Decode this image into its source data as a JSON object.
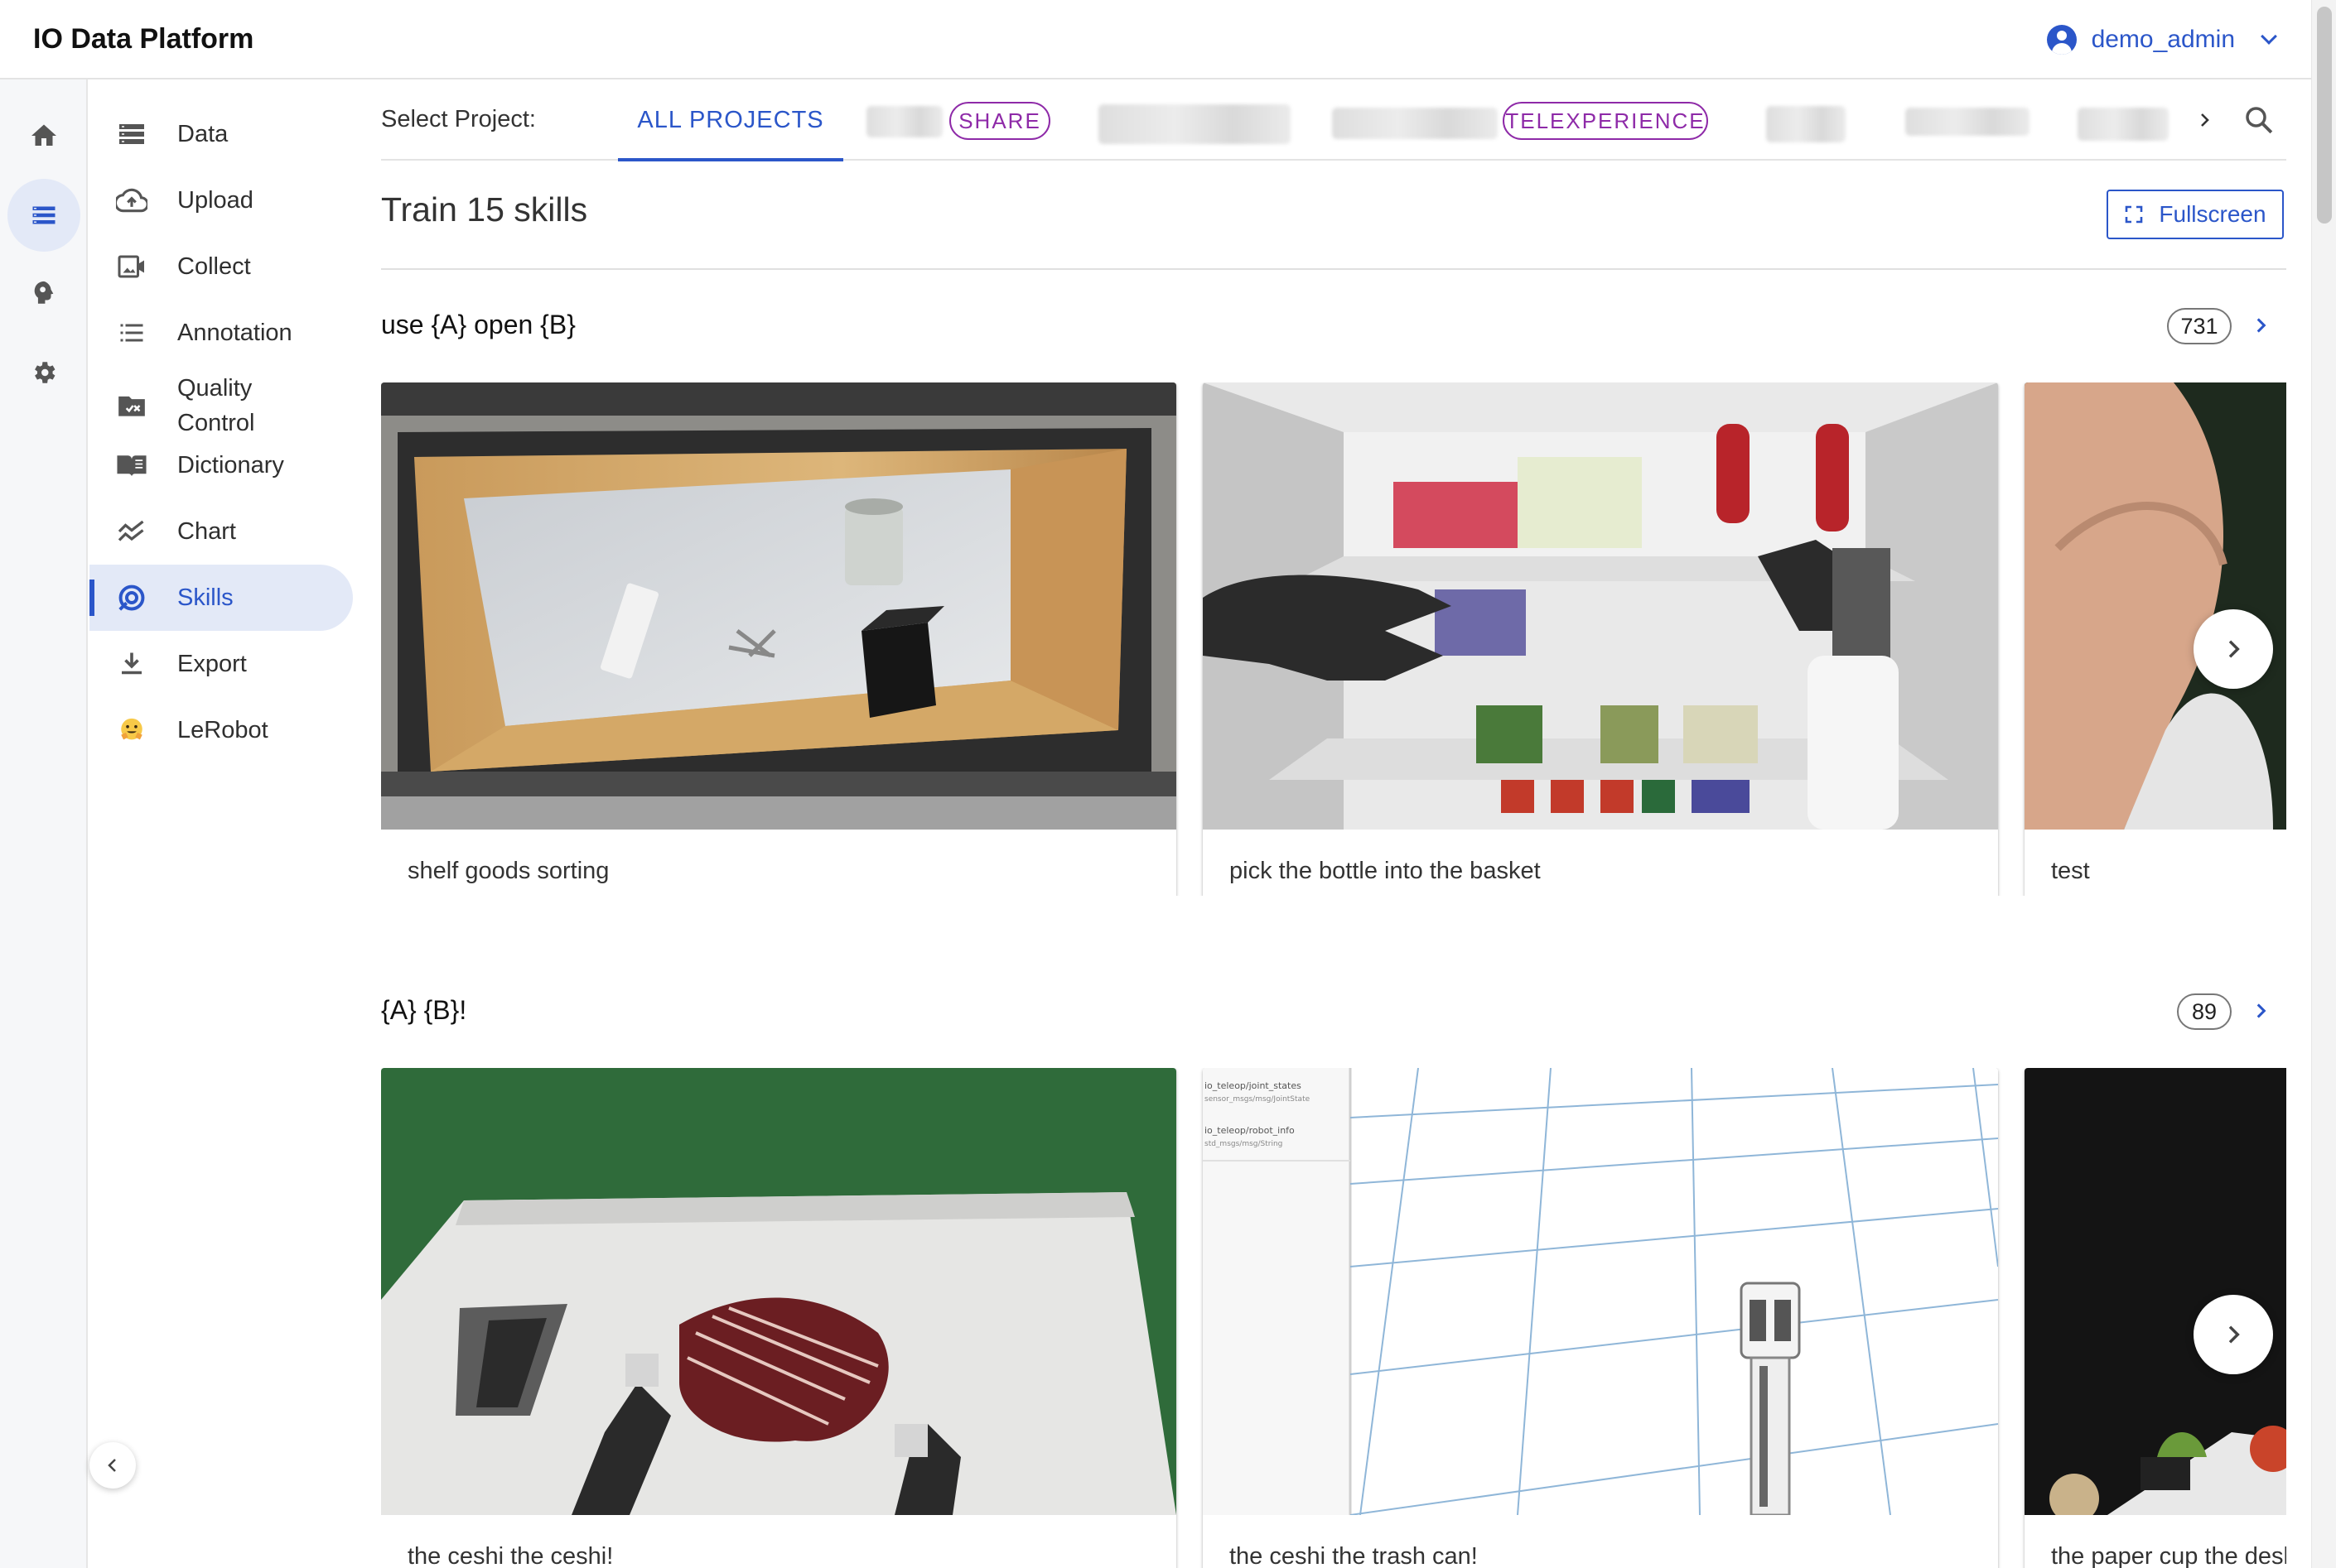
{
  "app": {
    "title": "IO Data Platform"
  },
  "user": {
    "name": "demo_admin"
  },
  "rail": {
    "items": [
      {
        "name": "home",
        "icon": "home-icon"
      },
      {
        "name": "data",
        "icon": "list-icon"
      },
      {
        "name": "brain",
        "icon": "brain-icon"
      },
      {
        "name": "settings",
        "icon": "gear-icon"
      }
    ]
  },
  "sidebar": {
    "items": [
      {
        "label": "Data",
        "icon": "storage-icon"
      },
      {
        "label": "Upload",
        "icon": "cloud-upload-icon"
      },
      {
        "label": "Collect",
        "icon": "video-collect-icon"
      },
      {
        "label": "Annotation",
        "icon": "list-icon"
      },
      {
        "label": "Quality Control",
        "icon": "folder-check-icon"
      },
      {
        "label": "Dictionary",
        "icon": "book-icon"
      },
      {
        "label": "Chart",
        "icon": "chart-icon"
      },
      {
        "label": "Skills",
        "icon": "skills-icon"
      },
      {
        "label": "Export",
        "icon": "download-icon"
      },
      {
        "label": "LeRobot",
        "icon": "hugging-face-icon"
      }
    ],
    "active": "Skills"
  },
  "projects": {
    "select_label": "Select Project:",
    "tabs": [
      "ALL PROJECTS"
    ],
    "chips": [
      "SHARE",
      "TELEXPERIENCE"
    ],
    "active_tab": "ALL PROJECTS"
  },
  "page": {
    "title": "Train 15 skills",
    "fullscreen_label": "Fullscreen"
  },
  "sections": [
    {
      "title": "use {A} open {B}",
      "count": "731",
      "cards": [
        {
          "caption": "shelf goods sorting"
        },
        {
          "caption": "pick the bottle into the basket"
        },
        {
          "caption": "test"
        }
      ]
    },
    {
      "title": "{A} {B}!",
      "count": "89",
      "cards": [
        {
          "caption": "the ceshi the ceshi!"
        },
        {
          "caption": "the ceshi the trash can!"
        },
        {
          "caption": "the paper cup the desk"
        }
      ]
    }
  ],
  "sim_panel": {
    "topics": [
      {
        "topic": "io_teleop/joint_states",
        "type": "sensor_msgs/msg/JointState"
      },
      {
        "topic": "io_teleop/robot_info",
        "type": "std_msgs/msg/String"
      }
    ]
  },
  "colors": {
    "accent": "#2b56c9",
    "chip": "#8e2aa8",
    "active_bg": "#e3e9f7"
  }
}
